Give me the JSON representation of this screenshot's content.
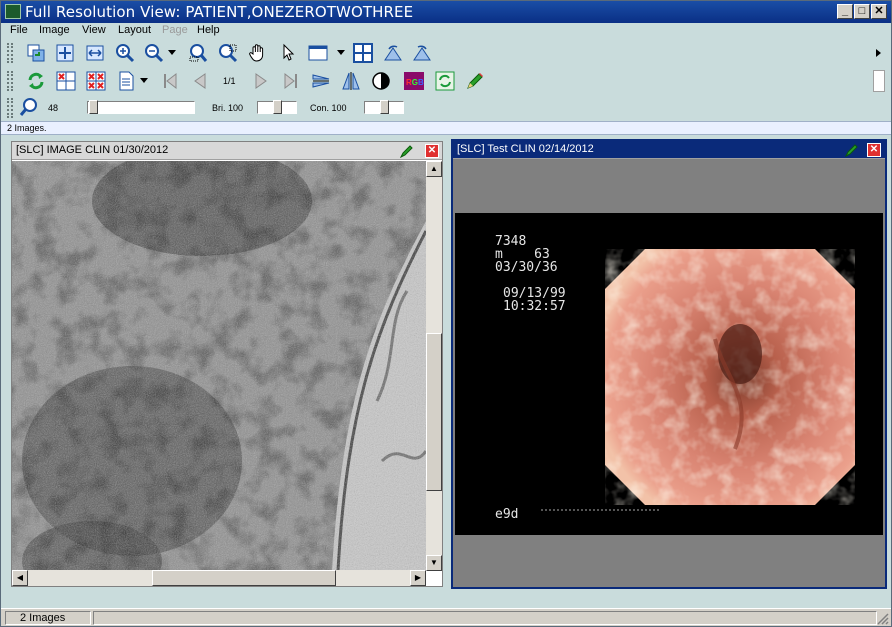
{
  "window": {
    "title": "Full Resolution View: PATIENT,ONEZEROTWOTHREE",
    "minimize": "_",
    "maximize": "□",
    "close": "✕"
  },
  "menu": [
    "File",
    "Image",
    "View",
    "Layout",
    "Page",
    "Help"
  ],
  "menu_disabled": [
    "Page"
  ],
  "toolbar1_icons": [
    "copy-image-icon",
    "fit-to-window-icon",
    "fit-width-icon",
    "zoom-in-icon",
    "zoom-out-icon",
    "dropdown-arrow-icon",
    "zoom-rect-icon",
    "zoom-region-icon",
    "pan-hand-icon",
    "pointer-icon",
    "layout-icon",
    "dropdown-arrow-icon",
    "grid-icon",
    "rotate-left-icon",
    "rotate-right-icon"
  ],
  "toolbar2": {
    "page_indicator": "1/1",
    "rgb_label": "RGB"
  },
  "toolbar3": {
    "zoom_value": "48",
    "brightness_label": "Bri. 100",
    "contrast_label": "Con. 100",
    "zoom_level": 0.02,
    "brightness_level": 0.5,
    "contrast_level": 0.5
  },
  "infobar": {
    "text": "2 Images."
  },
  "panes": [
    {
      "title": "[SLC] IMAGE CLIN 01/30/2012",
      "active": false
    },
    {
      "title": "[SLC] Test CLIN 02/14/2012",
      "active": true,
      "overlay": {
        "id": "7348",
        "sex_age": "m    63",
        "dob": "03/30/36",
        "date": "09/13/99",
        "time": "10:32:57",
        "footer": "e9d"
      }
    }
  ],
  "status": {
    "text": "2 Images"
  },
  "colors": {
    "titlebar": "#0a2f85",
    "background": "#c9dcdc",
    "active_pane": "#0a2a7a"
  }
}
